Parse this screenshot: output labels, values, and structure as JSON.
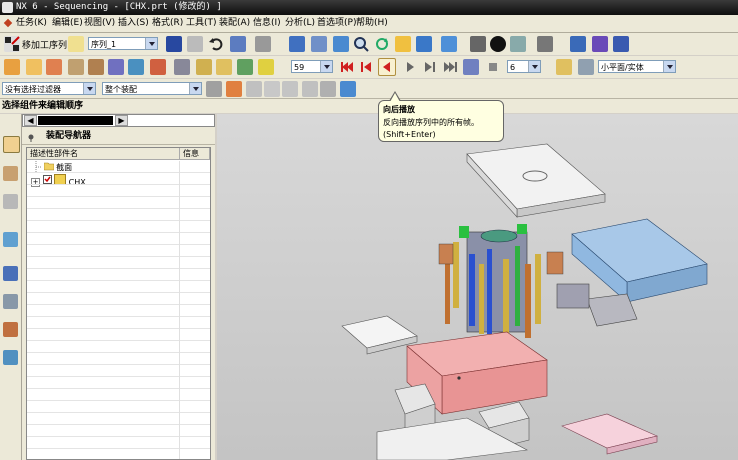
{
  "window": {
    "title": "NX 6 - Sequencing - [CHX.prt  (修改的) ]"
  },
  "menu": {
    "items": [
      "任务(K)",
      "编辑(E)",
      "视图(V)",
      "插入(S)",
      "格式(R)",
      "工具(T)",
      "装配(A)",
      "信息(I)",
      "分析(L)",
      "首选项(P)",
      "帮助(H)"
    ]
  },
  "toolbar1": {
    "insert_motion_label": "移加工序列",
    "sequence_select": "序列_1"
  },
  "toolbar2": {
    "frame_field": "59",
    "step_field": "6",
    "render_mode_select": "小平面/实体"
  },
  "toolbar3": {
    "selection_filter": "没有选择过滤器",
    "assembly_scope": "整个装配"
  },
  "cue_line": {
    "text": "选择组件来编辑顺序"
  },
  "tooltip": {
    "title": "向后播放",
    "description": "反向播放序列中的所有帧。",
    "shortcut": "(Shift+Enter)"
  },
  "navigator": {
    "title": "装配导航器",
    "columns": [
      "描述性部件名",
      "信息"
    ],
    "rows": [
      {
        "label": "截面",
        "type": "section-folder"
      },
      {
        "label": "CHX",
        "type": "assembly",
        "checked": true
      }
    ]
  },
  "colors": {
    "title_bar": "#1a1a1a",
    "toolbar_bg": "#ece9d8",
    "tooltip_bg": "#ffffe1",
    "viewport_bg": "#cfcfcf",
    "play_red": "#d02020"
  },
  "icons": {
    "menu_start": "nx-menu-icon",
    "play_backward": "play-backward-icon",
    "play_forward": "play-forward-icon",
    "stop": "stop-icon"
  }
}
